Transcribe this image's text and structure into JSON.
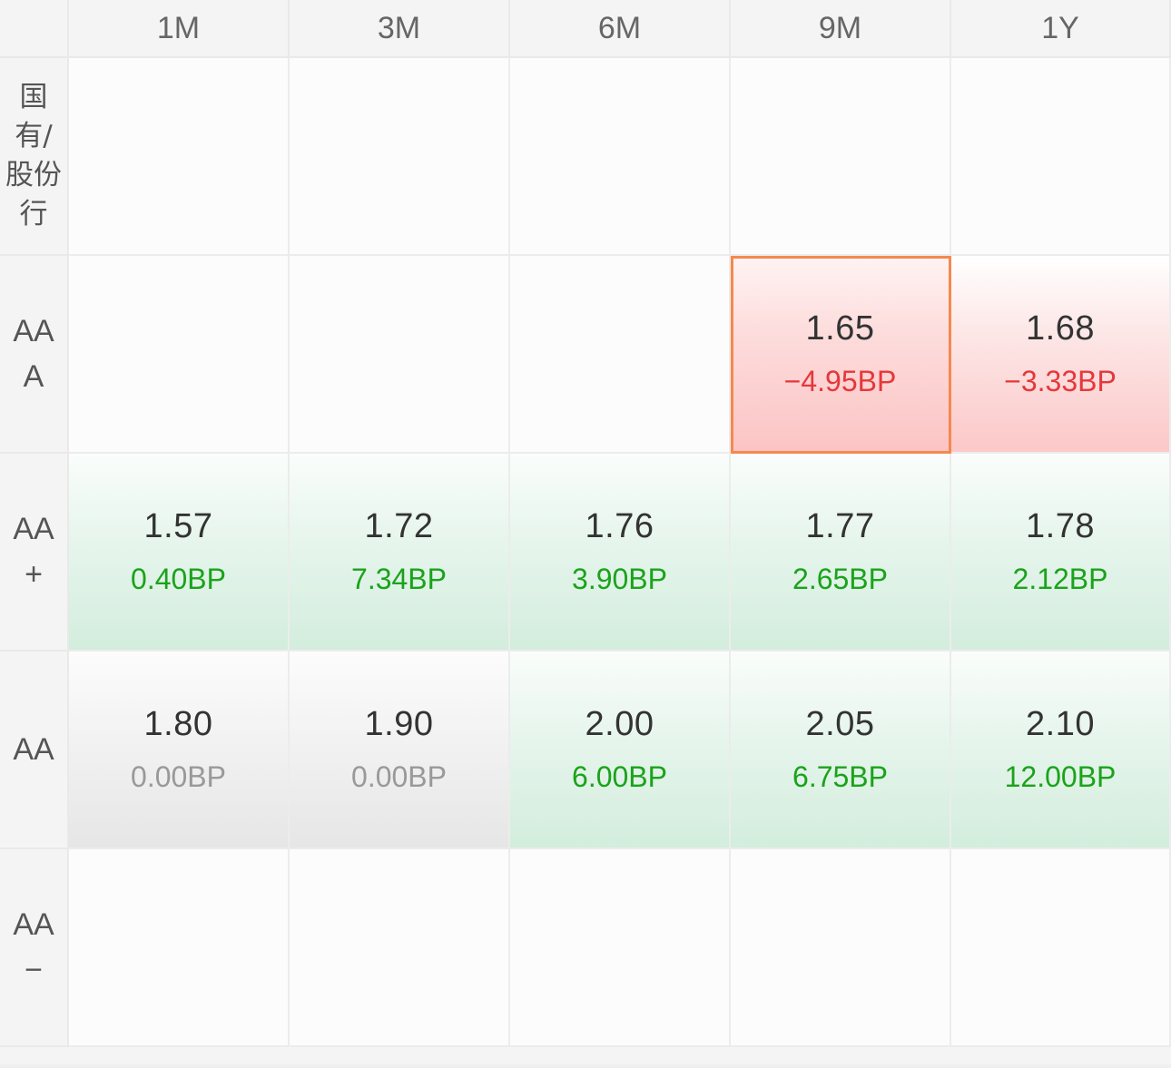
{
  "columns": [
    "1M",
    "3M",
    "6M",
    "9M",
    "1Y"
  ],
  "rows": [
    {
      "label": "国\n有/\n股份\n行",
      "cells": [
        {
          "value": "",
          "change": "",
          "trend": "empty"
        },
        {
          "value": "",
          "change": "",
          "trend": "empty"
        },
        {
          "value": "",
          "change": "",
          "trend": "empty"
        },
        {
          "value": "",
          "change": "",
          "trend": "empty"
        },
        {
          "value": "",
          "change": "",
          "trend": "empty"
        }
      ]
    },
    {
      "label": "AA\nA",
      "cells": [
        {
          "value": "",
          "change": "",
          "trend": "empty"
        },
        {
          "value": "",
          "change": "",
          "trend": "empty"
        },
        {
          "value": "",
          "change": "",
          "trend": "empty"
        },
        {
          "value": "1.65",
          "change": "−4.95BP",
          "trend": "up",
          "selected": true
        },
        {
          "value": "1.68",
          "change": "−3.33BP",
          "trend": "up"
        }
      ]
    },
    {
      "label": "AA\n+",
      "cells": [
        {
          "value": "1.57",
          "change": "0.40BP",
          "trend": "down"
        },
        {
          "value": "1.72",
          "change": "7.34BP",
          "trend": "down"
        },
        {
          "value": "1.76",
          "change": "3.90BP",
          "trend": "down"
        },
        {
          "value": "1.77",
          "change": "2.65BP",
          "trend": "down"
        },
        {
          "value": "1.78",
          "change": "2.12BP",
          "trend": "down"
        }
      ]
    },
    {
      "label": "AA",
      "cells": [
        {
          "value": "1.80",
          "change": "0.00BP",
          "trend": "flat"
        },
        {
          "value": "1.90",
          "change": "0.00BP",
          "trend": "flat"
        },
        {
          "value": "2.00",
          "change": "6.00BP",
          "trend": "down"
        },
        {
          "value": "2.05",
          "change": "6.75BP",
          "trend": "down"
        },
        {
          "value": "2.10",
          "change": "12.00BP",
          "trend": "down"
        }
      ]
    },
    {
      "label": "AA\n−",
      "cells": [
        {
          "value": "",
          "change": "",
          "trend": "empty"
        },
        {
          "value": "",
          "change": "",
          "trend": "empty"
        },
        {
          "value": "",
          "change": "",
          "trend": "empty"
        },
        {
          "value": "",
          "change": "",
          "trend": "empty"
        },
        {
          "value": "",
          "change": "",
          "trend": "empty"
        }
      ]
    }
  ],
  "colors": {
    "up_text": "#e5383b",
    "down_text": "#1aa31a",
    "flat_text": "#999999",
    "selected_border": "#f5894e"
  }
}
